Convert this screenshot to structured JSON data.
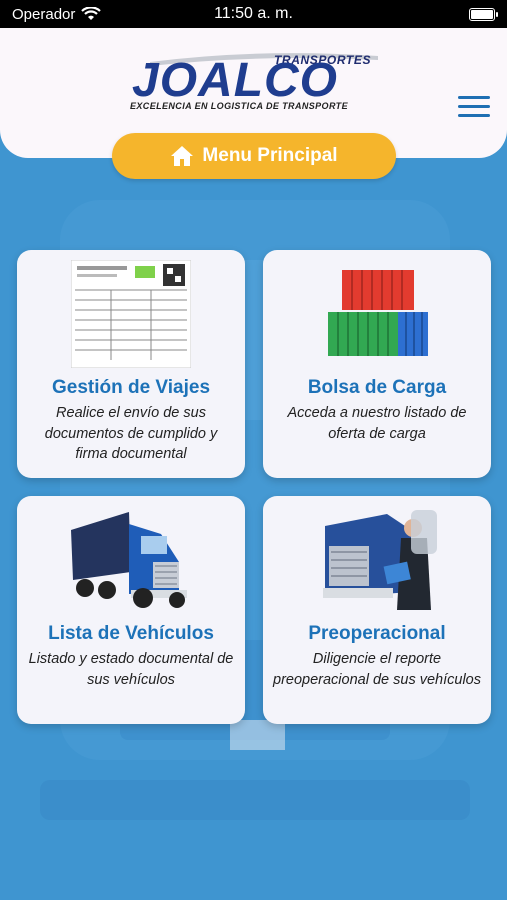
{
  "status_bar": {
    "carrier": "Operador",
    "time": "11:50 a. m."
  },
  "header": {
    "logo_top": "TRANSPORTES",
    "logo_main": "JOALCO",
    "logo_subtitle": "EXCELENCIA EN LOGISTICA DE TRANSPORTE",
    "menu_icon": "hamburger-menu-icon"
  },
  "main_menu": {
    "label": "Menu Principal",
    "icon": "home-icon"
  },
  "cards": [
    {
      "title": "Gestión de Viajes",
      "description": "Realice el envío de sus documentos de cumplido y firma documental",
      "image": "document-image"
    },
    {
      "title": "Bolsa de Carga",
      "description": "Acceda a nuestro listado de oferta de carga",
      "image": "containers-image"
    },
    {
      "title": "Lista de Vehículos",
      "description": "Listado y estado documental de sus vehículos",
      "image": "truck-image"
    },
    {
      "title": "Preoperacional",
      "description": "Diligencie el reporte preoperacional de sus vehículos",
      "image": "inspection-image"
    }
  ],
  "colors": {
    "primary": "#1d72b8",
    "accent": "#f5b52c",
    "background": "#3f95d0",
    "card": "#f4f4fa"
  }
}
